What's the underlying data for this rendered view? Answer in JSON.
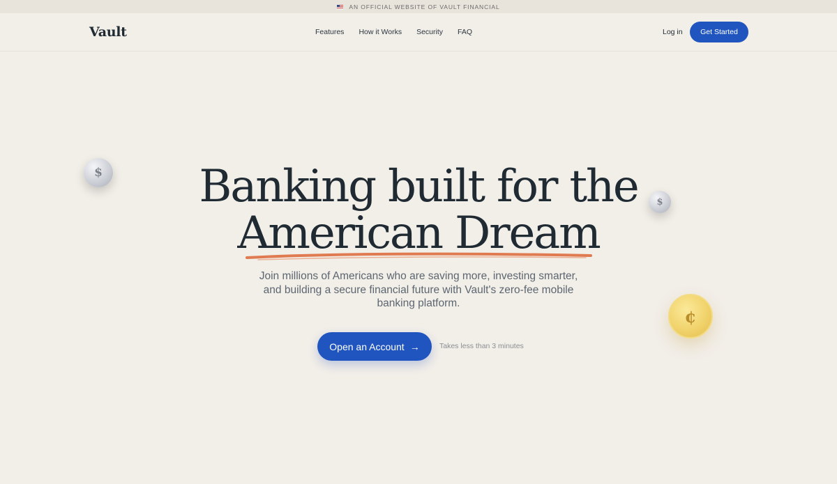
{
  "banner": {
    "text": "AN OFFICIAL WEBSITE OF VAULT FINANCIAL",
    "flag_icon": "us-flag-icon"
  },
  "header": {
    "logo": "Vault",
    "nav": [
      "Features",
      "How it Works",
      "Security",
      "FAQ"
    ],
    "login_label": "Log in",
    "get_started_label": "Get Started"
  },
  "hero": {
    "title_line1": "Banking built for the",
    "title_line2": "American Dream",
    "subtitle": "Join millions of Americans who are saving more, investing smarter, and building a secure financial future with Vault's zero-fee mobile banking platform.",
    "cta_label": "Open an Account",
    "cta_icon": "arrow-right-icon",
    "cta_note": "Takes less than 3 minutes"
  },
  "coins": {
    "silver_large": "$",
    "silver_small": "$",
    "gold": "¢"
  },
  "colors": {
    "background": "#f2eee8",
    "accent": "#2055c0",
    "underline": "#e07a50",
    "text": "#1f2a33"
  }
}
